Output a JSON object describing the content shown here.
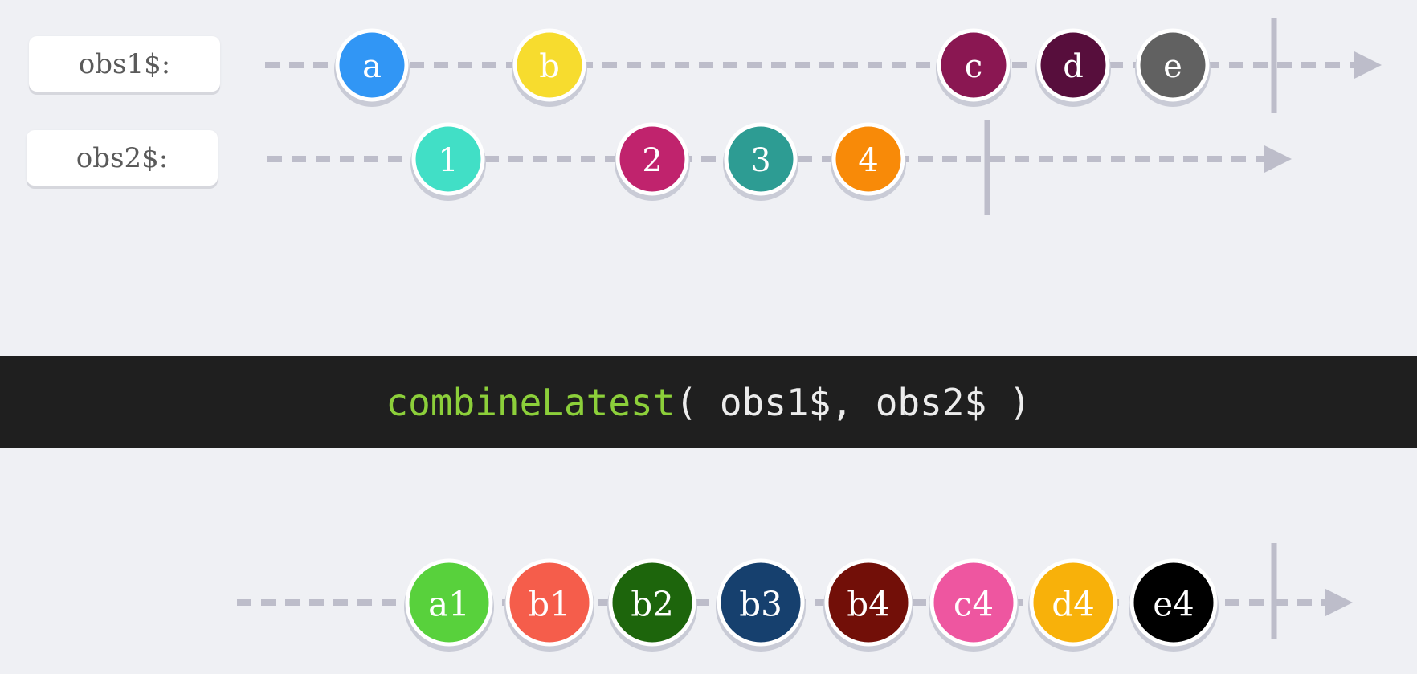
{
  "streams": [
    {
      "id": "obs1",
      "label": "obs1$:",
      "marbles": [
        {
          "text": "a",
          "color": "#3196f5"
        },
        {
          "text": "b",
          "color": "#f7dc2e"
        },
        {
          "text": "c",
          "color": "#8a1752"
        },
        {
          "text": "d",
          "color": "#570e3c"
        },
        {
          "text": "e",
          "color": "#616161"
        }
      ]
    },
    {
      "id": "obs2",
      "label": "obs2$:",
      "marbles": [
        {
          "text": "1",
          "color": "#41dfc6"
        },
        {
          "text": "2",
          "color": "#c0236d"
        },
        {
          "text": "3",
          "color": "#2d9c93"
        },
        {
          "text": "4",
          "color": "#f88a08"
        }
      ]
    }
  ],
  "operator": {
    "fn": "combineLatest",
    "args": "( obs1$, obs2$ )"
  },
  "output": {
    "id": "result",
    "marbles": [
      {
        "text": "a1",
        "color": "#58d13c"
      },
      {
        "text": "b1",
        "color": "#f55d4b"
      },
      {
        "text": "b2",
        "color": "#1d650c"
      },
      {
        "text": "b3",
        "color": "#16406e"
      },
      {
        "text": "b4",
        "color": "#720f08"
      },
      {
        "text": "c4",
        "color": "#ee56a0"
      },
      {
        "text": "d4",
        "color": "#f8b10a"
      },
      {
        "text": "e4",
        "color": "#000000"
      }
    ]
  },
  "colors": {
    "background": "#eff0f4",
    "timeline": "#bdbdca",
    "operator_bg": "#1f1f1f",
    "operator_fn": "#8ccf3a",
    "operator_args": "#ececec"
  }
}
